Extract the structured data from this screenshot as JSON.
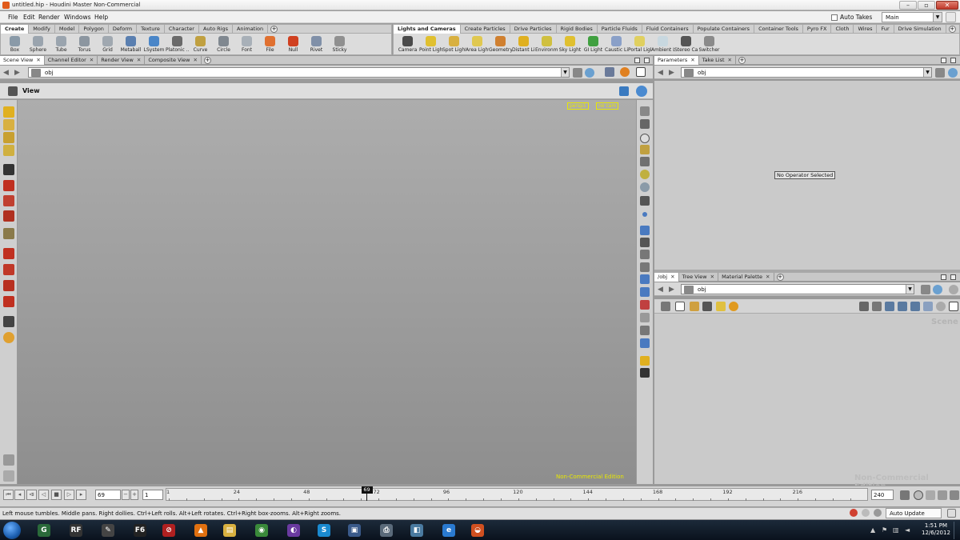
{
  "window": {
    "title": "untitled.hip - Houdini Master Non-Commercial",
    "minimize": "–",
    "maximize": "▫",
    "close": "✕"
  },
  "menu": {
    "items": [
      "File",
      "Edit",
      "Render",
      "Windows",
      "Help"
    ],
    "auto_takes": "Auto Takes",
    "desktop": "Main"
  },
  "shelf_left": {
    "tabs": [
      "Create",
      "Modify",
      "Model",
      "Polygon",
      "Deform",
      "Texture",
      "Character",
      "Auto Rigs",
      "Animation"
    ],
    "active_tab": "Create",
    "tools": [
      {
        "label": "Box",
        "icon": "box-icon",
        "color": "#8a9aa8"
      },
      {
        "label": "Sphere",
        "icon": "sphere-icon",
        "color": "#9aa4ae"
      },
      {
        "label": "Tube",
        "icon": "tube-icon",
        "color": "#9aa4ae"
      },
      {
        "label": "Torus",
        "icon": "torus-icon",
        "color": "#8c96a0"
      },
      {
        "label": "Grid",
        "icon": "grid-icon",
        "color": "#a0a8b0"
      },
      {
        "label": "Metaball",
        "icon": "metaball-icon",
        "color": "#5a7fb0"
      },
      {
        "label": "LSystem",
        "icon": "lsystem-icon",
        "color": "#4a86c8"
      },
      {
        "label": "Platonic ...",
        "icon": "platonic-icon",
        "color": "#6a6a6a"
      },
      {
        "label": "Curve",
        "icon": "curve-icon",
        "color": "#c0a040"
      },
      {
        "label": "Circle",
        "icon": "circle-icon",
        "color": "#808890"
      },
      {
        "label": "Font",
        "icon": "font-icon",
        "color": "#a8b0b8"
      },
      {
        "label": "File",
        "icon": "file-icon",
        "color": "#e07030"
      },
      {
        "label": "Null",
        "icon": "null-icon",
        "color": "#d04020"
      },
      {
        "label": "Rivet",
        "icon": "rivet-icon",
        "color": "#8090a8"
      },
      {
        "label": "Sticky",
        "icon": "sticky-icon",
        "color": "#909090"
      }
    ]
  },
  "shelf_right": {
    "tabs": [
      "Lights and Cameras",
      "Create Particles",
      "Drive Particles",
      "Rigid Bodies",
      "Particle Fluids",
      "Fluid Containers",
      "Populate Containers",
      "Container Tools",
      "Pyro FX",
      "Cloth",
      "Wires",
      "Fur",
      "Drive Simulation"
    ],
    "active_tab": "Lights and Cameras",
    "tools": [
      {
        "label": "Camera",
        "icon": "camera-icon",
        "color": "#4a4a4a"
      },
      {
        "label": "Point Light",
        "icon": "point-light-icon",
        "color": "#e0c030"
      },
      {
        "label": "Spot Light",
        "icon": "spot-light-icon",
        "color": "#d8b040"
      },
      {
        "label": "Area Light",
        "icon": "area-light-icon",
        "color": "#e0c850"
      },
      {
        "label": "Geometry...",
        "icon": "geometry-light-icon",
        "color": "#d08030"
      },
      {
        "label": "Distant Li...",
        "icon": "distant-light-icon",
        "color": "#e0b020"
      },
      {
        "label": "Environm...",
        "icon": "environment-light-icon",
        "color": "#d0c040"
      },
      {
        "label": "Sky Light",
        "icon": "sky-light-icon",
        "color": "#e0c030"
      },
      {
        "label": "GI Light",
        "icon": "gi-light-icon",
        "color": "#40a040"
      },
      {
        "label": "Caustic Li...",
        "icon": "caustic-light-icon",
        "color": "#8aa0c8"
      },
      {
        "label": "Portal Light",
        "icon": "portal-light-icon",
        "color": "#e0d060"
      },
      {
        "label": "Ambient L...",
        "icon": "ambient-light-icon",
        "color": "#c8d8e0"
      },
      {
        "label": "Stereo Ca...",
        "icon": "stereo-camera-icon",
        "color": "#555555"
      },
      {
        "label": "Switcher",
        "icon": "switcher-icon",
        "color": "#8a8a8a"
      }
    ]
  },
  "left_pane": {
    "tabs": [
      "Scene View",
      "Channel Editor",
      "Render View",
      "Composite View"
    ],
    "active_tab": "Scene View",
    "path": "obj",
    "view_label": "View",
    "camera_menu": "persp1",
    "cam_menu": "no cam",
    "watermark": "Non-Commercial Edition"
  },
  "param_pane": {
    "tabs": [
      "Parameters",
      "Take List"
    ],
    "active_tab": "Parameters",
    "path": "obj",
    "message": "No Operator Selected"
  },
  "net_pane": {
    "tabs": [
      "/obj",
      "Tree View",
      "Material Palette"
    ],
    "active_tab": "/obj",
    "path": "obj",
    "context_label": "Scene",
    "watermark": "Non-Commercial Edition"
  },
  "timeline": {
    "current_frame": "69",
    "start_frame": "1",
    "end_frame": "240",
    "ticks": [
      "1",
      "24",
      "48",
      "72",
      "96",
      "120",
      "144",
      "168",
      "192",
      "216"
    ],
    "update_mode": "Auto Update"
  },
  "status": {
    "hint": "Left mouse tumbles. Middle pans. Right dollies. Ctrl+Left rolls. Alt+Left rotates. Ctrl+Right box-zooms. Alt+Right zooms."
  },
  "taskbar": {
    "apps": [
      {
        "name": "gmail-notifier",
        "glyph": "G",
        "color": "#2a6a3a"
      },
      {
        "name": "rf-app",
        "glyph": "RF",
        "color": "#333333"
      },
      {
        "name": "wacom-app",
        "glyph": "✎",
        "color": "#444444"
      },
      {
        "name": "f6-app",
        "glyph": "F6",
        "color": "#222222"
      },
      {
        "name": "alert-app",
        "glyph": "⊘",
        "color": "#b02020"
      },
      {
        "name": "vlc-app",
        "glyph": "▲",
        "color": "#e07010"
      },
      {
        "name": "explorer-app",
        "glyph": "▤",
        "color": "#d8b040"
      },
      {
        "name": "chrome-app",
        "glyph": "◉",
        "color": "#3a8a3a"
      },
      {
        "name": "torrent-app",
        "glyph": "◐",
        "color": "#6a3aa0"
      },
      {
        "name": "skype-app",
        "glyph": "S",
        "color": "#1a8ad0"
      },
      {
        "name": "display-app",
        "glyph": "▣",
        "color": "#3a5a8a"
      },
      {
        "name": "printer-app",
        "glyph": "⎙",
        "color": "#5a6a7a"
      },
      {
        "name": "tool-app",
        "glyph": "◧",
        "color": "#4a7aa0"
      },
      {
        "name": "ie-app",
        "glyph": "e",
        "color": "#2a7ad0"
      },
      {
        "name": "houdini-app",
        "glyph": "◒",
        "color": "#d05020"
      }
    ],
    "time": "1:51 PM",
    "date": "12/6/2012"
  }
}
